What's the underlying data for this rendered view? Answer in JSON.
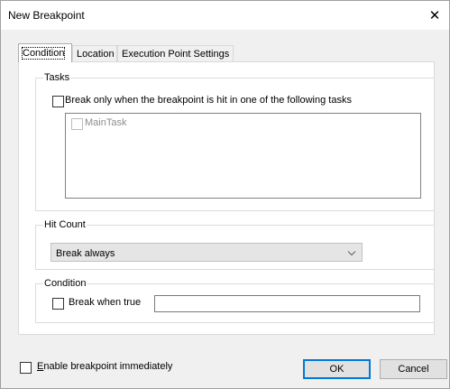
{
  "window": {
    "title": "New Breakpoint",
    "close_glyph": "✕"
  },
  "tabs": [
    {
      "label": "Condition",
      "active": true
    },
    {
      "label": "Location",
      "active": false
    },
    {
      "label": "Execution Point Settings",
      "active": false
    }
  ],
  "tasks": {
    "group_label": "Tasks",
    "checkbox_label": "Break only when the breakpoint is hit in one of the following tasks",
    "checked": false,
    "items": [
      {
        "label": "MainTask",
        "checked": false,
        "enabled": false
      }
    ]
  },
  "hit_count": {
    "group_label": "Hit Count",
    "selected": "Break always"
  },
  "condition": {
    "group_label": "Condition",
    "checkbox_label": "Break when true",
    "checked": false,
    "value": ""
  },
  "footer": {
    "enable_label": "Enable breakpoint immediately",
    "enable_checked": false,
    "ok_label": "OK",
    "cancel_label": "Cancel"
  },
  "colors": {
    "default_button_border": "#0078d7",
    "dialog_bg": "#f0f0f0"
  }
}
